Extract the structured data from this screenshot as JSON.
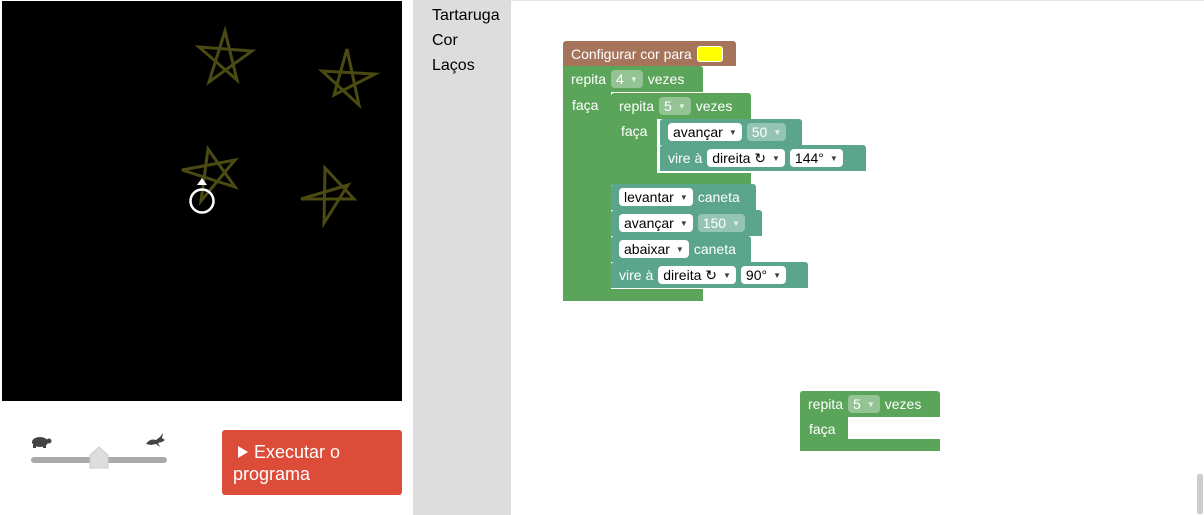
{
  "toolbox": {
    "categories": [
      "Tartaruga",
      "Cor",
      "Laços"
    ]
  },
  "run_button": {
    "label": "Executar o programa"
  },
  "speed": {
    "level": 0.5
  },
  "canvas": {
    "pen_color": "#4a4a12",
    "background": "#000000"
  },
  "program": {
    "set_color": {
      "label": "Configurar cor para",
      "color": "#ffff00"
    },
    "outer_repeat": {
      "repeat_label": "repita",
      "times": "4",
      "times_label": "vezes",
      "do_label": "faça"
    },
    "inner_repeat": {
      "repeat_label": "repita",
      "times": "5",
      "times_label": "vezes",
      "do_label": "faça"
    },
    "move_1": {
      "action": "avançar",
      "amount": "50"
    },
    "turn_1": {
      "label": "vire à",
      "direction": "direita ↻",
      "angle": "144°"
    },
    "pen_up": {
      "state": "levantar",
      "label": "caneta"
    },
    "move_2": {
      "action": "avançar",
      "amount": "150"
    },
    "pen_down": {
      "state": "abaixar",
      "label": "caneta"
    },
    "turn_2": {
      "label": "vire à",
      "direction": "direita ↻",
      "angle": "90°"
    }
  },
  "loose_block": {
    "repeat_label": "repita",
    "times": "5",
    "times_label": "vezes",
    "do_label": "faça"
  }
}
